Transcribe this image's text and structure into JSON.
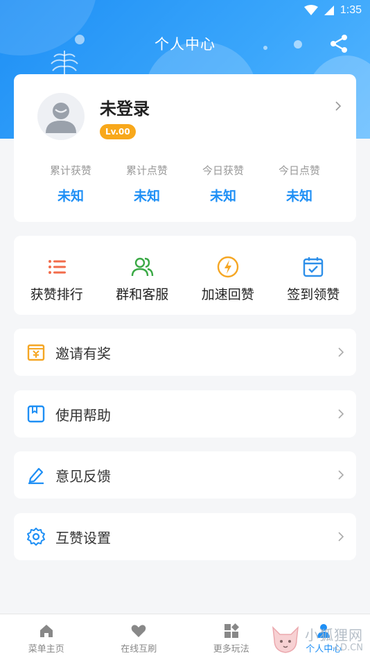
{
  "status_bar": {
    "time": "1:35"
  },
  "header": {
    "title": "个人中心"
  },
  "profile": {
    "name": "未登录",
    "level": "Lv.00",
    "stats": [
      {
        "label": "累计获赞",
        "value": "未知"
      },
      {
        "label": "累计点赞",
        "value": "未知"
      },
      {
        "label": "今日获赞",
        "value": "未知"
      },
      {
        "label": "今日点赞",
        "value": "未知"
      }
    ]
  },
  "actions": [
    {
      "label": "获赞排行",
      "icon": "list-icon",
      "color": "#f26b4a"
    },
    {
      "label": "群和客服",
      "icon": "group-icon",
      "color": "#3aa945"
    },
    {
      "label": "加速回赞",
      "icon": "lightning-icon",
      "color": "#f5a623"
    },
    {
      "label": "签到领赞",
      "icon": "calendar-check-icon",
      "color": "#2d8fe9"
    }
  ],
  "menu": [
    {
      "label": "邀请有奖",
      "icon": "gift-icon",
      "color": "#f5a623"
    },
    {
      "label": "使用帮助",
      "icon": "book-icon",
      "color": "#1e8ff5"
    },
    {
      "label": "意见反馈",
      "icon": "edit-icon",
      "color": "#1e8ff5"
    },
    {
      "label": "互赞设置",
      "icon": "gear-icon",
      "color": "#1e8ff5"
    }
  ],
  "bottom_nav": [
    {
      "label": "菜单主页",
      "icon": "home-icon"
    },
    {
      "label": "在线互刷",
      "icon": "heart-icon"
    },
    {
      "label": "更多玩法",
      "icon": "apps-icon"
    },
    {
      "label": "个人中心",
      "icon": "person-icon",
      "active": true
    }
  ],
  "watermark": {
    "main": "小狐狸网",
    "sub": "-LD.CN"
  },
  "colors": {
    "primary": "#1e8ff5",
    "level_badge": "#f8a81b"
  }
}
